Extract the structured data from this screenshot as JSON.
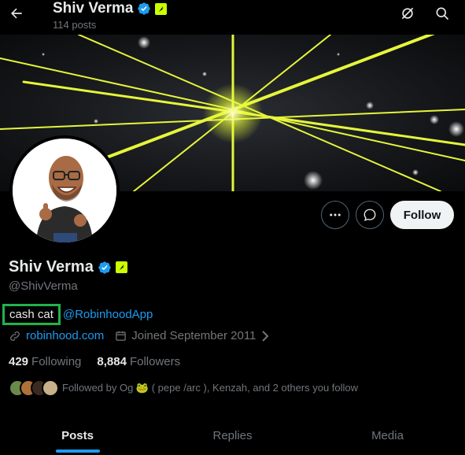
{
  "header": {
    "name": "Shiv Verma",
    "posts": "114 posts",
    "icons": [
      "back-arrow-icon",
      "grok-icon",
      "search-icon"
    ]
  },
  "profile": {
    "name": "Shiv Verma",
    "handle": "@ShivVerma",
    "bio_text": "cash cat",
    "bio_mention": "@RobinhoodApp",
    "website": "robinhood.com",
    "joined": "Joined September 2011",
    "following_count": "429",
    "following_label": "Following",
    "followers_count": "8,884",
    "followers_label": "Followers",
    "followed_by": "Followed by Og 🐸 ( pepe /arc ), Kenzah, and 2 others you follow"
  },
  "actions": {
    "follow_label": "Follow"
  },
  "tabs": [
    {
      "label": "Posts",
      "active": true
    },
    {
      "label": "Replies",
      "active": false
    },
    {
      "label": "Media",
      "active": false
    }
  ],
  "colors": {
    "accent": "#1d9bf0",
    "highlight_box": "#22b24c",
    "badge": "#ccff00",
    "background": "#000000"
  }
}
